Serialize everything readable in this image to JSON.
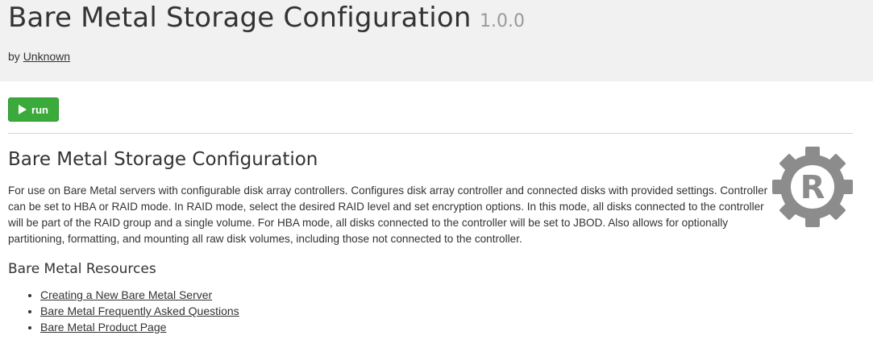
{
  "header": {
    "title": "Bare Metal Storage Configuration",
    "version": "1.0.0",
    "author_prefix": "by",
    "author_name": "Unknown"
  },
  "toolbar": {
    "run_label": "run",
    "run_icon": "play-icon",
    "run_color": "#3aab3a"
  },
  "main": {
    "section_title": "Bare Metal Storage Configuration",
    "description": "For use on Bare Metal servers with configurable disk array controllers. Configures disk array controller and connected disks with provided settings. Controller can be set to HBA or RAID mode. In RAID mode, select the desired RAID level and set encryption options. In this mode, all disks connected to the controller will be part of the RAID group and a single volume. For HBA mode, all disks connected to the controller will be set to JBOD. Also allows for optionally partitioning, formatting, and mounting all raw disk volumes, including those not connected to the controller.",
    "logo": {
      "icon": "gear-r-logo-icon",
      "letter": "R",
      "color": "#8c8c8c"
    },
    "resources": {
      "title": "Bare Metal Resources",
      "links": [
        "Creating a New Bare Metal Server",
        "Bare Metal Frequently Asked Questions",
        "Bare Metal Product Page"
      ]
    }
  }
}
